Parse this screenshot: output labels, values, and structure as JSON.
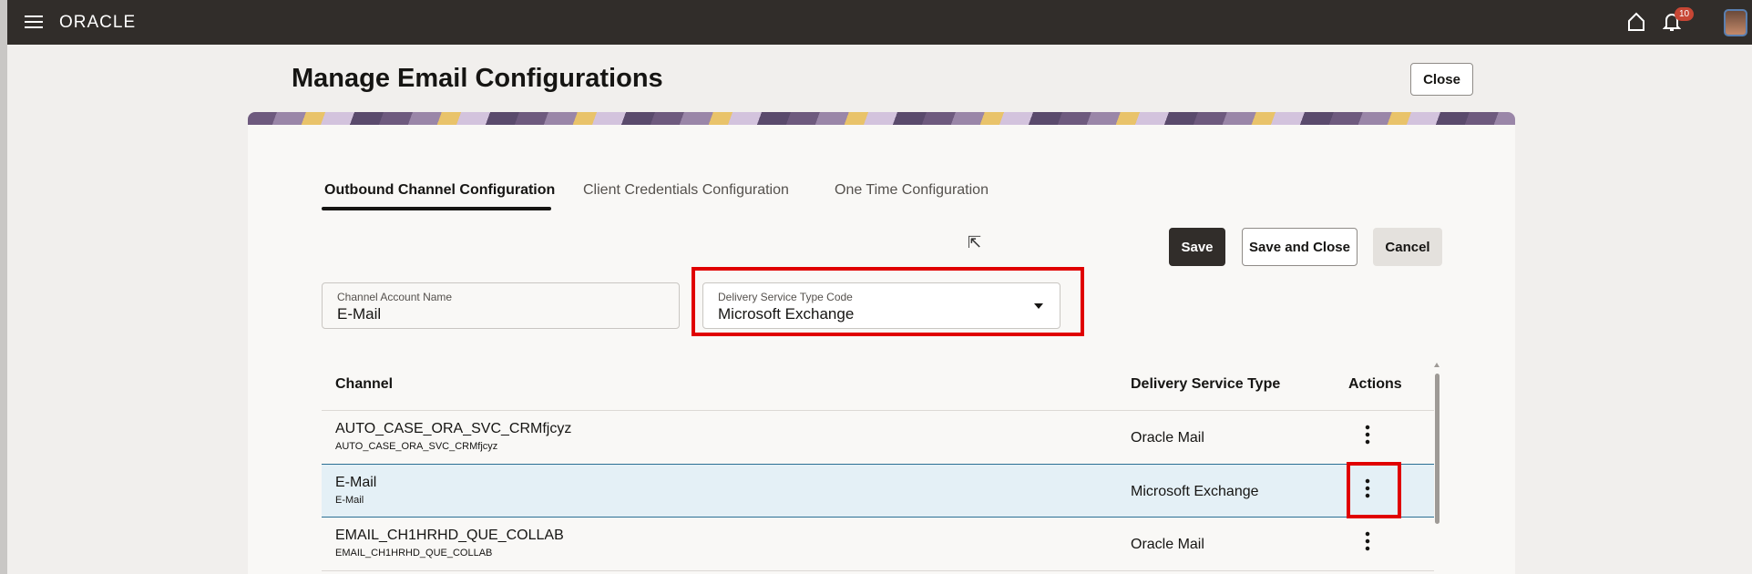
{
  "header": {
    "logo": "ORACLE",
    "notification_count": "10"
  },
  "page": {
    "title": "Manage Email Configurations",
    "close_label": "Close"
  },
  "tabs": [
    {
      "label": "Outbound Channel Configuration",
      "selected": true
    },
    {
      "label": "Client Credentials Configuration"
    },
    {
      "label": "One Time Configuration"
    }
  ],
  "actions": {
    "save": "Save",
    "save_and_close": "Save and Close",
    "cancel": "Cancel"
  },
  "form": {
    "channel_account_name": {
      "label": "Channel Account Name",
      "value": "E-Mail"
    },
    "delivery_service_type_code": {
      "label": "Delivery Service Type Code",
      "value": "Microsoft Exchange"
    }
  },
  "table": {
    "headers": [
      "Channel",
      "Delivery Service Type",
      "Actions"
    ],
    "rows": [
      {
        "channel": "AUTO_CASE_ORA_SVC_CRMfjcyz",
        "sub": "AUTO_CASE_ORA_SVC_CRMfjcyz",
        "type": "Oracle Mail"
      },
      {
        "channel": "E-Mail",
        "sub": "E-Mail",
        "type": "Microsoft Exchange",
        "selected": true
      },
      {
        "channel": "EMAIL_CH1HRHD_QUE_COLLAB",
        "sub": "EMAIL_CH1HRHD_QUE_COLLAB",
        "type": "Oracle Mail"
      }
    ]
  }
}
